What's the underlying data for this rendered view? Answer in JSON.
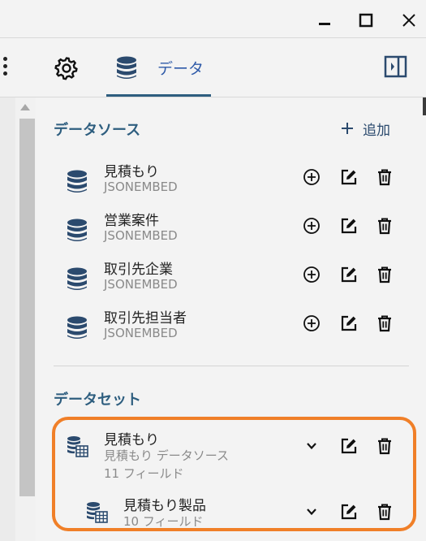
{
  "window": {
    "minimize_icon": "minimize-icon",
    "maximize_icon": "maximize-icon",
    "close_icon": "close-icon"
  },
  "tabs": {
    "data_tab_label": "データ",
    "settings_icon": "gear-icon",
    "data_icon": "database-icon",
    "panel_icon": "panel-toggle-icon"
  },
  "data_sources": {
    "title": "データソース",
    "add_label": "追加",
    "items": [
      {
        "name": "見積もり",
        "type": "JSONEMBED"
      },
      {
        "name": "営業案件",
        "type": "JSONEMBED"
      },
      {
        "name": "取引先企業",
        "type": "JSONEMBED"
      },
      {
        "name": "取引先担当者",
        "type": "JSONEMBED"
      }
    ]
  },
  "data_sets": {
    "title": "データセット",
    "items": [
      {
        "name": "見積もり",
        "source": "見積もり データソース",
        "fields": "11 フィールド"
      },
      {
        "name": "見積もり製品",
        "fields": "10 フィールド"
      }
    ]
  },
  "colors": {
    "accent": "#2e5e7f",
    "tab_label": "#2e5aa8",
    "highlight": "#f07f28",
    "icon_dark": "#2b4a6e"
  }
}
